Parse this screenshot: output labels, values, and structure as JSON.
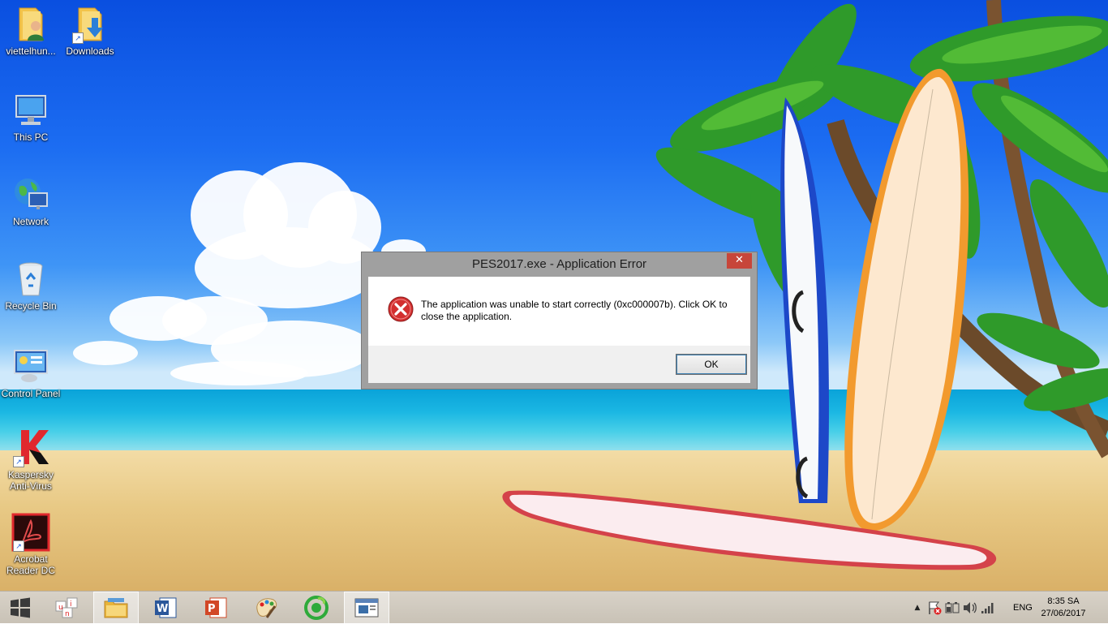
{
  "desktop_icons": [
    {
      "label": "viettelhun...",
      "icon": "user-folder-icon"
    },
    {
      "label": "Downloads",
      "icon": "downloads-folder-icon"
    },
    {
      "label": "This PC",
      "icon": "computer-icon"
    },
    {
      "label": "Network",
      "icon": "network-icon"
    },
    {
      "label": "Recycle Bin",
      "icon": "recycle-bin-icon"
    },
    {
      "label": "Control Panel",
      "icon": "control-panel-icon"
    },
    {
      "label": "Kaspersky Anti-Virus",
      "icon": "kaspersky-icon"
    },
    {
      "label": "Acrobat Reader DC",
      "icon": "acrobat-icon"
    }
  ],
  "dialog": {
    "title": "PES2017.exe - Application Error",
    "close_label": "✕",
    "icon": "error-icon",
    "message": "The application was unable to start correctly (0xc000007b). Click OK to close the application.",
    "ok_label": "OK"
  },
  "taskbar": {
    "apps": [
      {
        "icon": "start-windows-icon"
      },
      {
        "icon": "unikey-icon"
      },
      {
        "icon": "file-explorer-icon"
      },
      {
        "icon": "word-icon"
      },
      {
        "icon": "powerpoint-icon"
      },
      {
        "icon": "paint-icon"
      },
      {
        "icon": "coccoc-browser-icon"
      },
      {
        "icon": "app-window-icon"
      }
    ],
    "tray": {
      "language": "ENG",
      "time": "8:35 SA",
      "date": "27/06/2017"
    }
  },
  "colors": {
    "close_button": "#c7463a",
    "error_red": "#d32f2f",
    "taskbar": "#cfc8bc"
  }
}
